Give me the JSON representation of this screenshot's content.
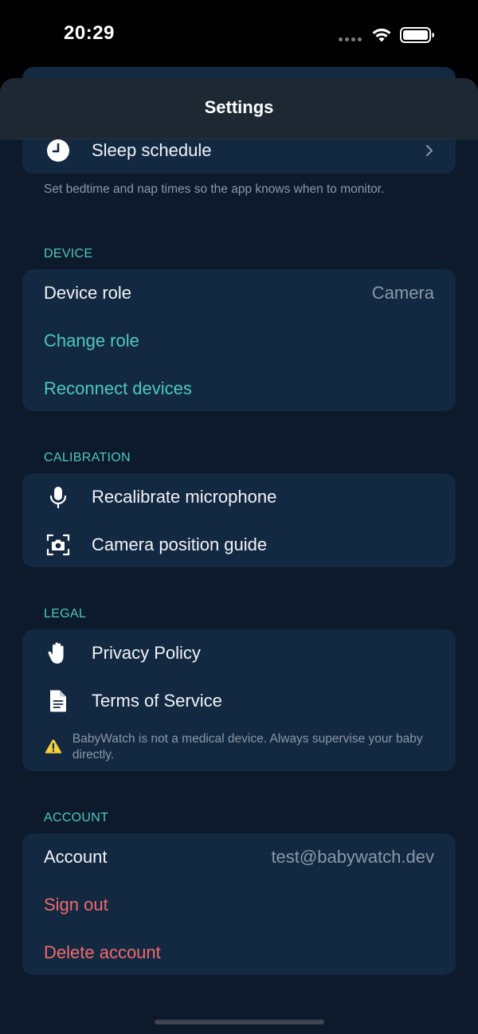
{
  "status_bar": {
    "time": "20:29"
  },
  "nav": {
    "title": "Settings"
  },
  "schedule": {
    "sleep_schedule_label": "Sleep schedule",
    "footnote": "Set bedtime and nap times so the app knows when to monitor."
  },
  "device": {
    "header": "DEVICE",
    "role_label": "Device role",
    "role_value": "Camera",
    "change_role_label": "Change role",
    "reconnect_label": "Reconnect devices"
  },
  "calibration": {
    "header": "CALIBRATION",
    "recalibrate_label": "Recalibrate microphone",
    "camera_guide_label": "Camera position guide"
  },
  "legal": {
    "header": "LEGAL",
    "privacy_label": "Privacy Policy",
    "terms_label": "Terms of Service",
    "disclaimer": "BabyWatch is not a medical device. Always supervise your baby directly."
  },
  "account": {
    "header": "ACCOUNT",
    "account_label": "Account",
    "account_value": "test@babywatch.dev",
    "sign_out_label": "Sign out",
    "delete_label": "Delete account"
  },
  "icons": {
    "sleep": "clock-icon",
    "mic": "microphone-icon",
    "camera": "camera-icon",
    "privacy": "hand-icon",
    "terms": "document-icon",
    "warning": "warning-icon",
    "chevron": "chevron-right-icon"
  },
  "colors": {
    "background": "#0c1a2c",
    "card": "#132841",
    "accent_teal": "#4fc7c0",
    "destructive_red": "#f06b6b",
    "warning_yellow": "#f4d03f"
  }
}
